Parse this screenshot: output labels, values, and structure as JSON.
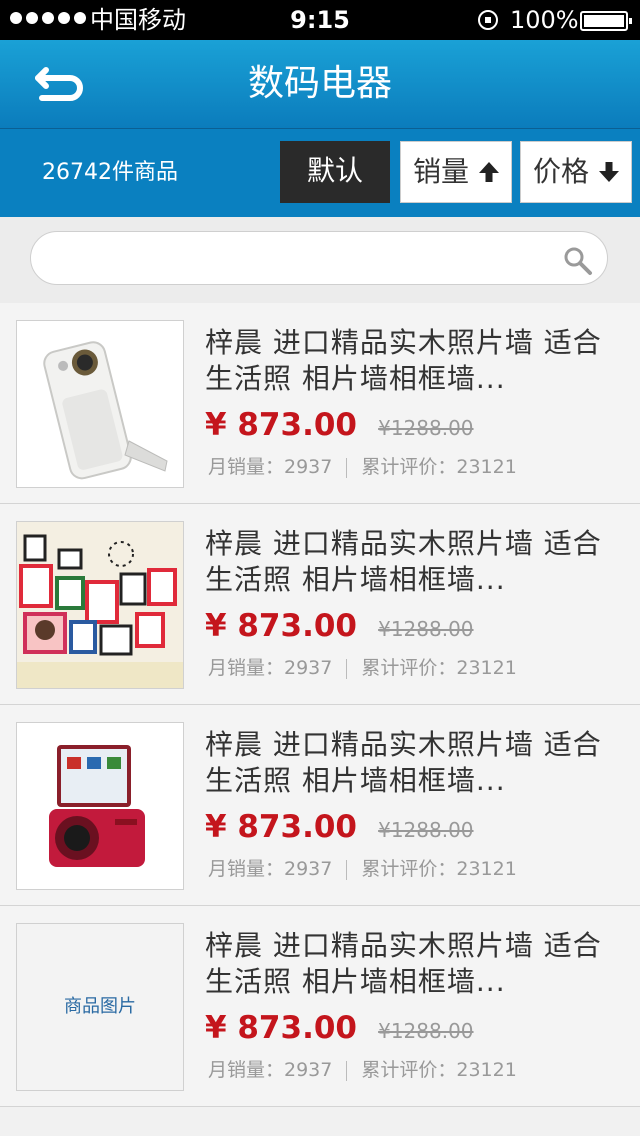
{
  "status_bar": {
    "carrier": "中国移动",
    "time": "9:15",
    "battery": "100%"
  },
  "nav": {
    "title": "数码电器",
    "back_icon": "back-arrow-icon"
  },
  "filter": {
    "count_text": "26742件商品",
    "sort_default": "默认",
    "sort_sales": "销量",
    "sort_price": "价格"
  },
  "search": {
    "value": "",
    "placeholder": ""
  },
  "products": [
    {
      "title": "梓晨  进口精品实木照片墙  适合生活照  相片墙相框墙...",
      "price": "¥ 873.00",
      "original_price": "¥1288.00",
      "monthly_sales": "月销量：2937",
      "total_reviews": "累计评价：23121",
      "image_placeholder": ""
    },
    {
      "title": "梓晨  进口精品实木照片墙  适合生活照  相片墙相框墙...",
      "price": "¥ 873.00",
      "original_price": "¥1288.00",
      "monthly_sales": "月销量：2937",
      "total_reviews": "累计评价：23121",
      "image_placeholder": ""
    },
    {
      "title": "梓晨  进口精品实木照片墙  适合生活照  相片墙相框墙...",
      "price": "¥ 873.00",
      "original_price": "¥1288.00",
      "monthly_sales": "月销量：2937",
      "total_reviews": "累计评价：23121",
      "image_placeholder": ""
    },
    {
      "title": "梓晨  进口精品实木照片墙  适合生活照  相片墙相框墙...",
      "price": "¥ 873.00",
      "original_price": "¥1288.00",
      "monthly_sales": "月销量：2937",
      "total_reviews": "累计评价：23121",
      "image_placeholder": "商品图片"
    }
  ],
  "colors": {
    "nav": "#1a9bd4",
    "price": "#c4151c",
    "sort_active": "#2a2a2a"
  }
}
